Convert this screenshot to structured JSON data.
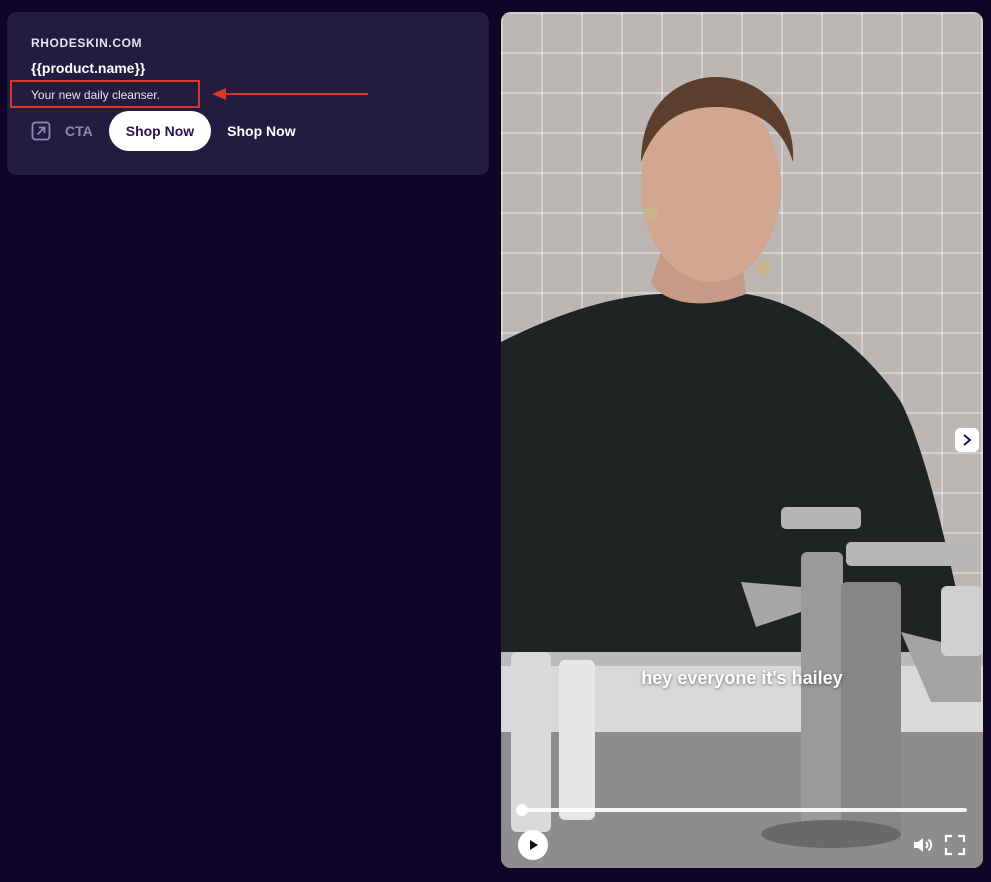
{
  "card": {
    "domain": "RHODESKIN.COM",
    "product_name": "{{product.name}}",
    "tagline": "Your new daily cleanser.",
    "cta": {
      "icon": "external-arrow-icon",
      "label": "CTA",
      "button_label": "Shop Now",
      "text_label": "Shop Now"
    },
    "annotation_color": "#d23b2b"
  },
  "video": {
    "subtitle": "hey everyone it's hailey",
    "progress": 0.0,
    "controls": {
      "play_icon": "play-icon",
      "volume_icon": "volume-icon",
      "fullscreen_icon": "fullscreen-icon",
      "next_icon": "chevron-right-icon"
    }
  },
  "colors": {
    "background": "#0f0526",
    "card": "#231c3e",
    "cta_label": "#8f86b4",
    "button_text": "#24144f"
  }
}
